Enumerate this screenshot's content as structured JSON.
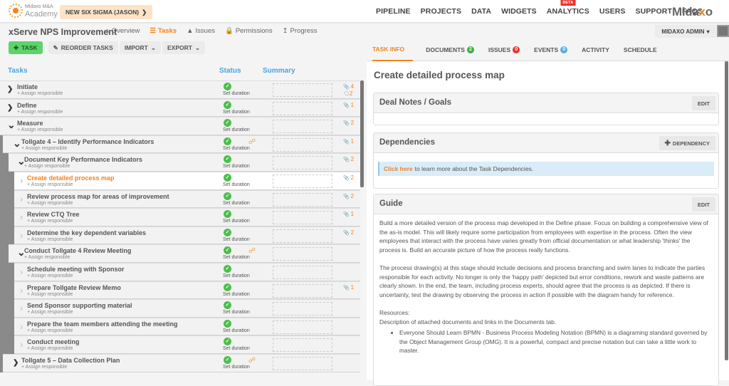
{
  "topbar": {
    "logo_line1": "Midaxo M&A",
    "logo_line2": "Academy",
    "project_selector": "NEW SIX SIGMA (JASON)",
    "nav": [
      "PIPELINE",
      "PROJECTS",
      "DATA",
      "WIDGETS",
      "ANALYTICS",
      "USERS",
      "SUPPORT",
      "FAQS"
    ],
    "beta_label": "BETA",
    "brand_a": "Mida",
    "brand_b": "x",
    "brand_c": "o"
  },
  "project": {
    "title": "xServe NPS Improvement",
    "nav": [
      {
        "label": "Overview",
        "icon": "home-icon"
      },
      {
        "label": "Tasks",
        "icon": "tasks-icon",
        "active": true
      },
      {
        "label": "Issues",
        "icon": "warning-icon"
      },
      {
        "label": "Permissions",
        "icon": "lock-icon"
      },
      {
        "label": "Progress",
        "icon": "chart-line-icon"
      }
    ],
    "user_menu": "MIDAXO ADMIN"
  },
  "toolbar": {
    "add_task": "TASK",
    "reorder": "REORDER TASKS",
    "import": "IMPORT",
    "export": "EXPORT"
  },
  "columns": {
    "tasks": "Tasks",
    "status": "Status",
    "summary": "Summary"
  },
  "assign_label": "+ Assign responsible",
  "status_label": "Set duration",
  "tasks": [
    {
      "name": "Initiate",
      "level": 0,
      "expanded": false,
      "attachments": "4",
      "comments": "2"
    },
    {
      "name": "Define",
      "level": 0,
      "expanded": false,
      "attachments": "1"
    },
    {
      "name": "Measure",
      "level": 0,
      "expanded": true,
      "attachments": "2"
    },
    {
      "name": "Tollgate 4 – Identify Performance Indicators",
      "level": 1,
      "expanded": true,
      "attachments": "1",
      "dependency": true
    },
    {
      "name": "Document Key Performance Indicators",
      "level": 2,
      "expanded": true,
      "attachments": "2"
    },
    {
      "name": "Create detailed process map",
      "level": 3,
      "selected": true,
      "attachments": "2"
    },
    {
      "name": "Review process map for areas of improvement",
      "level": 3,
      "attachments": "2"
    },
    {
      "name": "Review CTQ Tree",
      "level": 3,
      "attachments": "1"
    },
    {
      "name": "Determine the key dependent variables",
      "level": 3,
      "attachments": "2"
    },
    {
      "name": "Conduct Tollgate 4 Review Meeting",
      "level": 2,
      "expanded": true,
      "dependency": true
    },
    {
      "name": "Schedule meeting with Sponsor",
      "level": 3
    },
    {
      "name": "Prepare Tollgate Review Memo",
      "level": 3,
      "attachments": "1"
    },
    {
      "name": "Send Sponsor supporting material",
      "level": 3
    },
    {
      "name": "Prepare the team members attending the meeting",
      "level": 3
    },
    {
      "name": "Conduct meeting",
      "level": 3
    },
    {
      "name": "Tollgate 5 – Data Collection Plan",
      "level": 1,
      "expanded": false,
      "dependency": true
    }
  ],
  "detail": {
    "tabs": [
      {
        "label": "TASK INFO",
        "active": true
      },
      {
        "label": "DOCUMENTS",
        "badge": "2",
        "badge_color": "#3cb043"
      },
      {
        "label": "ISSUES",
        "badge": "0",
        "badge_color": "#e8322a"
      },
      {
        "label": "EVENTS",
        "badge": "0",
        "badge_color": "#5aace2"
      },
      {
        "label": "ACTIVITY"
      },
      {
        "label": "SCHEDULE"
      }
    ],
    "title": "Create detailed process map",
    "deal_notes": {
      "title": "Deal Notes / Goals",
      "edit": "EDIT"
    },
    "dependencies": {
      "title": "Dependencies",
      "add": "DEPENDENCY",
      "link": "Click here",
      "info": "to learn more about the Task Dependencies."
    },
    "guide": {
      "title": "Guide",
      "edit": "EDIT",
      "p1": "Build a more detailed version of the process map developed in the Define phase. Focus on building a comprehensive view of the as-is model. This will likely require some participation from employees with expertise in the process. Often the view employees that interact with the process have varies greatly from official documentation or what leadership 'thinks' the process is. Build an accurate picture of how the process really functions.",
      "p2": "The process drawing(s) at this stage should include decisions and process branching and swim lanes to indicate the parties responsible for each activity. No longer is only the 'happy path' depicted but error conditions, rework and waste patterns are clearly shown. In the end, the team, including process experts, should agree that the process is as depicted. If there is uncertainty, test the drawing by observing the process in action if possible with the diagram handy for reference.",
      "resources_label": "Resources:",
      "resources_desc": "Description of attached documents and links in the Documents tab.",
      "bullet1": "Everyone Should Learn BPMN - Business Process Modeling Notation (BPMN) is a diagraming standard governed by the Object Management Group (OMG). It is a powerful, compact and precise notation but can take a little work to master."
    }
  },
  "colors": {
    "accent": "#f58220",
    "link_blue": "#4aa3df",
    "success": "#4cbf4c",
    "add_green": "#5cd46a"
  }
}
